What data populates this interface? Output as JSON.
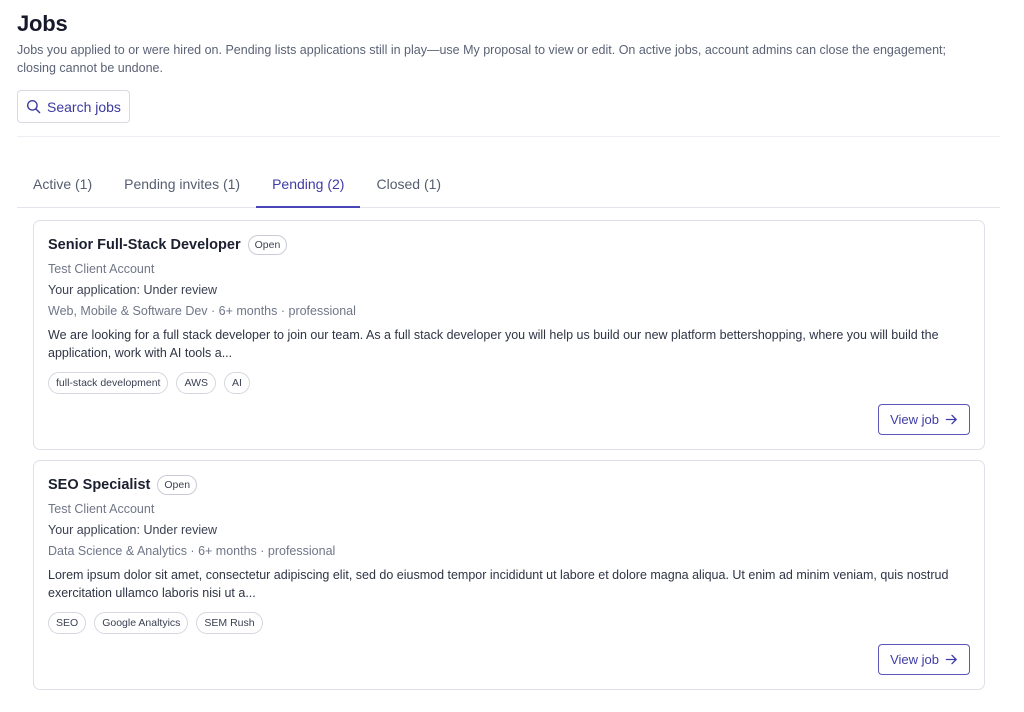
{
  "header": {
    "title": "Jobs",
    "description": "Jobs you applied to or were hired on. Pending lists applications still in play—use My proposal to view or edit. On active jobs, account admins can close the engagement; closing cannot be undone."
  },
  "search": {
    "label": "Search jobs",
    "icon": "search-icon"
  },
  "tabs": [
    {
      "label": "Active (1)",
      "active": false
    },
    {
      "label": "Pending invites (1)",
      "active": false
    },
    {
      "label": "Pending (2)",
      "active": true
    },
    {
      "label": "Closed (1)",
      "active": false
    }
  ],
  "jobs": [
    {
      "title": "Senior Full-Stack Developer",
      "badge": "Open",
      "client": "Test Client Account",
      "status": "Your application: Under review",
      "meta": "Web, Mobile & Software Dev · 6+ months · professional",
      "description": "We are looking for a full stack developer to join our team. As a full stack developer you will help us build our new platform bettershopping, where you will build the application, work with AI tools a...",
      "tags": [
        "full-stack development",
        "AWS",
        "AI"
      ],
      "button": "View job"
    },
    {
      "title": "SEO Specialist",
      "badge": "Open",
      "client": "Test Client Account",
      "status": "Your application: Under review",
      "meta": "Data Science & Analytics · 6+ months · professional",
      "description": "Lorem ipsum dolor sit amet, consectetur adipiscing elit, sed do eiusmod tempor incididunt ut labore et dolore magna aliqua. Ut enim ad minim veniam, quis nostrud exercitation ullamco laboris nisi ut a...",
      "tags": [
        "SEO",
        "Google Analtyics",
        "SEM Rush"
      ],
      "button": "View job"
    }
  ],
  "colors": {
    "accent": "#4a46b8",
    "text": "#1b2030",
    "muted": "#707688",
    "border": "#dfe1e8"
  }
}
